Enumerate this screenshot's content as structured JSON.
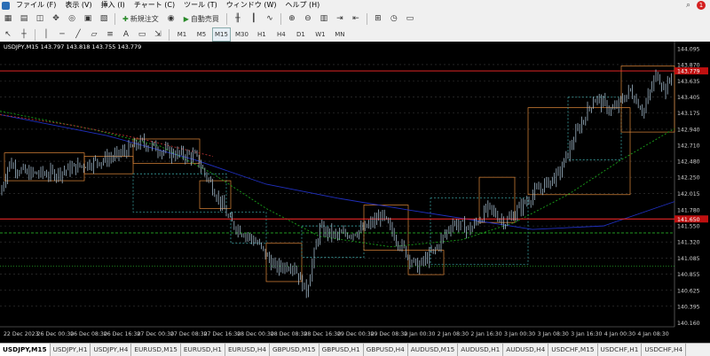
{
  "menu": [
    "ファイル (F)",
    "表示 (V)",
    "挿入 (I)",
    "チャート (C)",
    "ツール (T)",
    "ウィンドウ (W)",
    "ヘルプ (H)"
  ],
  "toolbar": {
    "new_order": "新規注文",
    "auto_trade": "自動売買"
  },
  "timeframes": [
    "M1",
    "M5",
    "M15",
    "M30",
    "H1",
    "H4",
    "D1",
    "W1",
    "MN"
  ],
  "active_timeframe": "M15",
  "chart": {
    "title": "USDJPY,M15  143.797 143.818 143.755 143.779",
    "current_price": "143.779",
    "marked_price": "141.650",
    "colors": {
      "background": "#000000",
      "candle": "#9fb7c8",
      "current": "#ff2a2a",
      "ma_blue": "#2030c0",
      "ma_green": "#1aa01a",
      "ma_red": "#b03030",
      "orange": "#e0883a",
      "cyan": "#40b0b0"
    }
  },
  "chart_data": {
    "type": "candlestick",
    "symbol": "USDJPY",
    "timeframe": "M15",
    "ohlc_last": {
      "open": 143.797,
      "high": 143.818,
      "low": 143.755,
      "close": 143.779
    },
    "price_axis": [
      "144.095",
      "143.870",
      "143.635",
      "143.405",
      "143.175",
      "142.940",
      "142.710",
      "142.480",
      "142.250",
      "142.015",
      "141.780",
      "141.550",
      "141.320",
      "141.085",
      "140.855",
      "140.625",
      "140.395",
      "140.160"
    ],
    "time_axis": [
      "22 Dec 2023",
      "26 Dec 00:30",
      "26 Dec 08:30",
      "26 Dec 16:30",
      "27 Dec 00:30",
      "27 Dec 08:30",
      "27 Dec 16:30",
      "28 Dec 00:30",
      "28 Dec 08:30",
      "28 Dec 16:30",
      "29 Dec 00:30",
      "29 Dec 08:30",
      "2 Jan 00:30",
      "2 Jan 08:30",
      "2 Jan 16:30",
      "3 Jan 00:30",
      "3 Jan 08:30",
      "3 Jan 16:30",
      "4 Jan 00:30",
      "4 Jan 08:30"
    ],
    "ylim": [
      140.1,
      144.2
    ]
  },
  "tabs": [
    "USDJPY,M15",
    "USDJPY,H1",
    "USDJPY,H4",
    "EURUSD,M15",
    "EURUSD,H1",
    "EURUSD,H4",
    "GBPUSD,M15",
    "GBPUSD,H1",
    "GBPUSD,H4",
    "AUDUSD,M15",
    "AUDUSD,H1",
    "AUDUSD,H4",
    "USDCHF,M15",
    "USDCHF,H1",
    "USDCHF,H4"
  ],
  "active_tab": "USDJPY,M15"
}
